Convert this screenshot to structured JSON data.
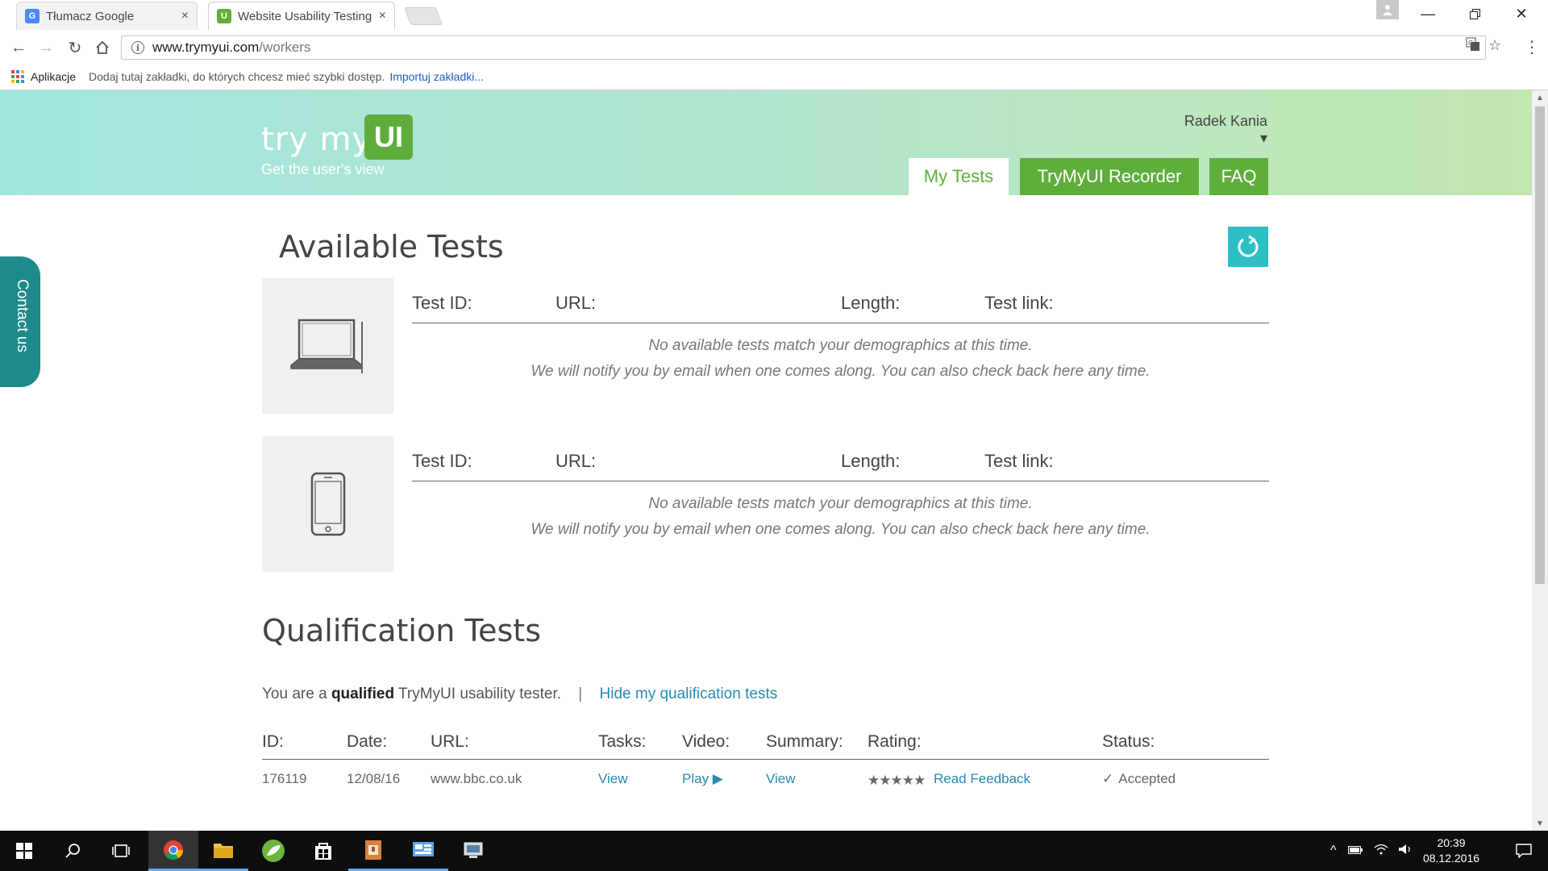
{
  "browser": {
    "tabs": [
      {
        "title": "Tłumacz Google",
        "close": "×"
      },
      {
        "title": "Website Usability Testing",
        "close": "×"
      }
    ],
    "url_host": "www.trymyui.com",
    "url_path": "/workers",
    "bookmarks": {
      "apps_label": "Aplikacje",
      "hint": "Dodaj tutaj zakładki, do których chcesz mieć szybki dostęp.",
      "import_link": "Importuj zakładki..."
    }
  },
  "header": {
    "logo_text": "try my",
    "logo_badge": "UI",
    "tagline": "Get the user's view",
    "user_name": "Radek Kania ▾",
    "nav": {
      "my_tests": "My Tests",
      "recorder": "TryMyUI Recorder",
      "faq": "FAQ"
    }
  },
  "contact_tab": "Contact us",
  "available": {
    "title": "Available Tests",
    "columns": {
      "test_id": "Test ID:",
      "url": "URL:",
      "length": "Length:",
      "test_link": "Test link:"
    },
    "blocks": [
      {
        "device": "laptop-icon",
        "msg_line1": "No available tests match your demographics at this time.",
        "msg_line2": "We will notify you by email when one comes along. You can also check back here any time."
      },
      {
        "device": "phone-icon",
        "msg_line1": "No available tests match your demographics at this time.",
        "msg_line2": "We will notify you by email when one comes along. You can also check back here any time."
      }
    ]
  },
  "qualification": {
    "title": "Qualification Tests",
    "note_prefix": "You are a",
    "note_bold": "qualified",
    "note_suffix": "TryMyUI usability tester.",
    "separator": "|",
    "hide_link": "Hide my qualification tests",
    "columns": [
      "ID:",
      "Date:",
      "URL:",
      "Tasks:",
      "Video:",
      "Summary:",
      "Rating:",
      "Status:"
    ],
    "rows": [
      {
        "id": "176119",
        "date": "12/08/16",
        "url": "www.bbc.co.uk",
        "tasks": "View",
        "video": "Play ▶",
        "summary": "View",
        "rating_stars": "★★★★★",
        "rating_link": "Read Feedback",
        "status": "Accepted"
      }
    ]
  },
  "taskbar": {
    "clock_time": "20:39",
    "clock_date": "08.12.2016"
  },
  "colors": {
    "brand_green": "#5fae3c",
    "teal": "#2cc0c5",
    "link_blue": "#2a8ab3"
  }
}
